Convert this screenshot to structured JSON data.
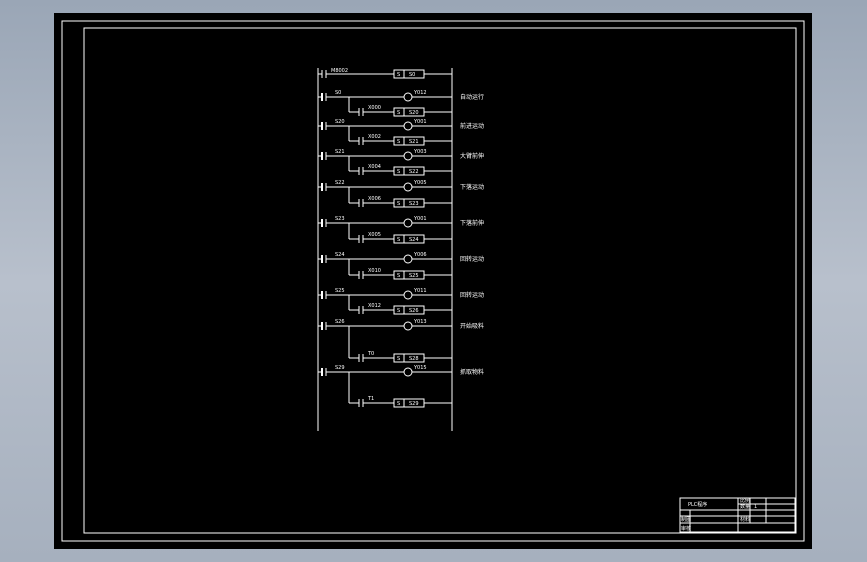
{
  "drawing": {
    "title_block": {
      "name": "PLC程序",
      "cells": [
        "比例",
        "1",
        "数量",
        "材料",
        "制图",
        "审核"
      ]
    },
    "start_contact": "M8002",
    "start_step": "S0",
    "rungs": [
      {
        "step": "S0",
        "output": "Y012",
        "label": "自动运行",
        "trans": "X000",
        "next": "S20"
      },
      {
        "step": "S20",
        "output": "Y001",
        "label": "前进运动",
        "trans": "X002",
        "next": "S21"
      },
      {
        "step": "S21",
        "output": "Y003",
        "label": "大臂前伸",
        "trans": "X004",
        "next": "S22"
      },
      {
        "step": "S22",
        "output": "Y005",
        "label": "下落运动",
        "trans": "X006",
        "next": "S23"
      },
      {
        "step": "S23",
        "output": "Y001",
        "label": "下落前伸",
        "trans": "X005",
        "next": "S24"
      },
      {
        "step": "S24",
        "output": "Y006",
        "label": "回转运动",
        "trans": "X010",
        "next": "S25"
      },
      {
        "step": "S25",
        "output": "Y011",
        "label": "回转运动",
        "trans": "X012",
        "next": "S26"
      },
      {
        "step": "S26",
        "output": "Y013",
        "label": "开始吸料",
        "trans": "T0",
        "next": "S28"
      },
      {
        "step": "S29",
        "output": "Y015",
        "label": "抓取物料",
        "trans": "T1",
        "next": "S29"
      }
    ],
    "set_letter": "S"
  }
}
